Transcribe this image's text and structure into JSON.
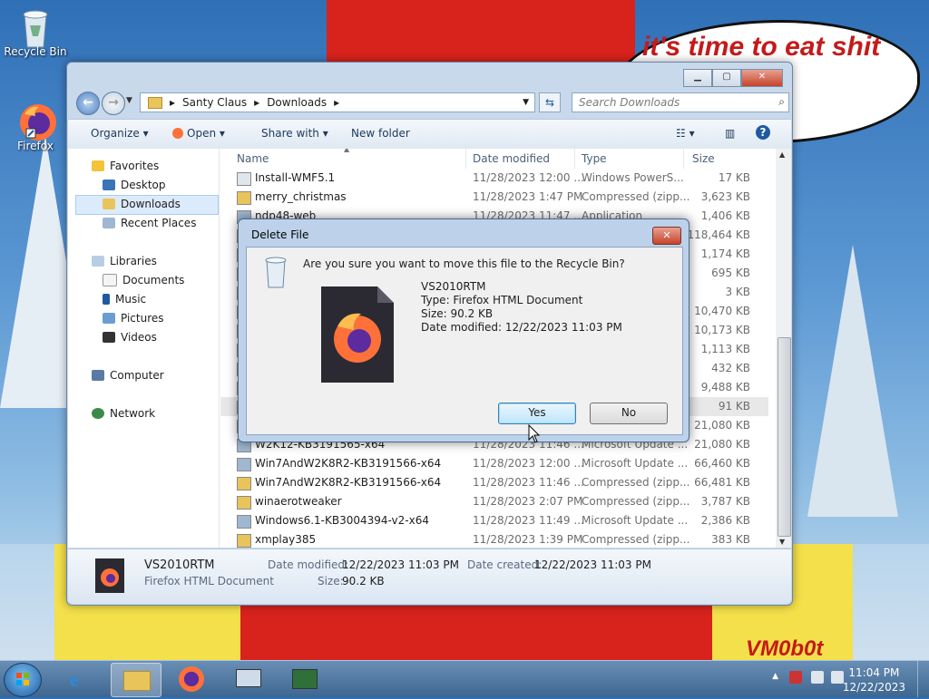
{
  "desktop": {
    "icons": [
      {
        "label": "Recycle Bin",
        "icon": "recycle-bin-icon"
      },
      {
        "label": "Firefox",
        "icon": "firefox-icon"
      }
    ],
    "wallpaper_text": "it's time to eat shit\nchew\nes",
    "signature": "VM0b0t"
  },
  "explorer": {
    "breadcrumb": [
      "Santy Claus",
      "Downloads"
    ],
    "search_placeholder": "Search Downloads",
    "toolbar": {
      "organize": "Organize",
      "open": "Open",
      "share_with": "Share with",
      "new_folder": "New folder"
    },
    "nav": {
      "favorites": "Favorites",
      "desktop": "Desktop",
      "downloads": "Downloads",
      "recent_places": "Recent Places",
      "libraries": "Libraries",
      "documents": "Documents",
      "music": "Music",
      "pictures": "Pictures",
      "videos": "Videos",
      "computer": "Computer",
      "network": "Network"
    },
    "columns": {
      "name": "Name",
      "date": "Date modified",
      "type": "Type",
      "size": "Size"
    },
    "rows": [
      {
        "name": "Install-WMF5.1",
        "date": "11/28/2023 12:00 ...",
        "type": "Windows PowerS...",
        "size": "17 KB",
        "icon": "file"
      },
      {
        "name": "merry_christmas",
        "date": "11/28/2023 1:47 PM",
        "type": "Compressed (zipp...",
        "size": "3,623 KB",
        "icon": "zip"
      },
      {
        "name": "ndp48-web",
        "date": "11/28/2023 11:47 ...",
        "type": "Application",
        "size": "1,406 KB",
        "icon": "app"
      },
      {
        "name": "",
        "date": "",
        "type": "",
        "size": "118,464 KB",
        "icon": "app"
      },
      {
        "name": "",
        "date": "",
        "type": "",
        "size": "1,174 KB",
        "icon": "zip"
      },
      {
        "name": "",
        "date": "",
        "type": "",
        "size": "695 KB",
        "icon": "zip"
      },
      {
        "name": "",
        "date": "",
        "type": "",
        "size": "3 KB",
        "icon": "file"
      },
      {
        "name": "",
        "date": "",
        "type": "",
        "size": "10,470 KB",
        "icon": "app"
      },
      {
        "name": "",
        "date": "",
        "type": "",
        "size": "10,173 KB",
        "icon": "zip"
      },
      {
        "name": "",
        "date": "",
        "type": "",
        "size": "1,113 KB",
        "icon": "zip"
      },
      {
        "name": "",
        "date": "",
        "type": "",
        "size": "432 KB",
        "icon": "zip"
      },
      {
        "name": "",
        "date": "",
        "type": "",
        "size": "9,488 KB",
        "icon": "zip"
      },
      {
        "name": "",
        "date": "",
        "type": "",
        "size": "91 KB",
        "icon": "firefox"
      },
      {
        "name": "",
        "date": "",
        "type": "",
        "size": "21,080 KB",
        "icon": "app"
      },
      {
        "name": "W2K12-KB3191565-x64",
        "date": "11/28/2023 11:46 ...",
        "type": "Microsoft Update ...",
        "size": "21,080 KB",
        "icon": "app"
      },
      {
        "name": "Win7AndW2K8R2-KB3191566-x64",
        "date": "11/28/2023 12:00 ...",
        "type": "Microsoft Update ...",
        "size": "66,460 KB",
        "icon": "app"
      },
      {
        "name": "Win7AndW2K8R2-KB3191566-x64",
        "date": "11/28/2023 11:46 ...",
        "type": "Compressed (zipp...",
        "size": "66,481 KB",
        "icon": "zip"
      },
      {
        "name": "winaerotweaker",
        "date": "11/28/2023 2:07 PM",
        "type": "Compressed (zipp...",
        "size": "3,787 KB",
        "icon": "zip"
      },
      {
        "name": "Windows6.1-KB3004394-v2-x64",
        "date": "11/28/2023 11:49 ...",
        "type": "Microsoft Update ...",
        "size": "2,386 KB",
        "icon": "app"
      },
      {
        "name": "xmplay385",
        "date": "11/28/2023 1:39 PM",
        "type": "Compressed (zipp...",
        "size": "383 KB",
        "icon": "zip"
      }
    ],
    "details": {
      "name": "VS2010RTM",
      "type": "Firefox HTML Document",
      "date_modified_label": "Date modified:",
      "date_modified": "12/22/2023 11:03 PM",
      "size_label": "Size:",
      "size": "90.2 KB",
      "date_created_label": "Date created:",
      "date_created": "12/22/2023 11:03 PM"
    }
  },
  "dialog": {
    "title": "Delete File",
    "close": "✕",
    "question": "Are you sure you want to move this file to the Recycle Bin?",
    "file_name": "VS2010RTM",
    "file_type": "Type: Firefox HTML Document",
    "file_size": "Size: 90.2 KB",
    "file_date": "Date modified: 12/22/2023 11:03 PM",
    "yes": "Yes",
    "no": "No"
  },
  "taskbar": {
    "time": "11:04 PM",
    "date": "12/22/2023"
  },
  "colors": {
    "accent": "#1e5aa1",
    "firefox_orange": "#ff7139",
    "firefox_purple": "#5c2b9e"
  }
}
